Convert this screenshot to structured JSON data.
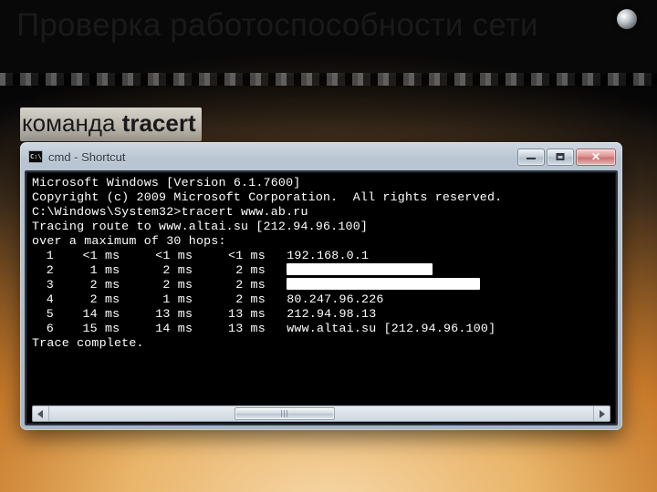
{
  "slide": {
    "title": "Проверка работоспособности сети",
    "subtitle_prefix": "команда ",
    "subtitle_cmd": "tracert"
  },
  "window": {
    "title": "cmd - Shortcut",
    "buttons": {
      "min": "Minimize",
      "max": "Maximize",
      "close": "Close"
    }
  },
  "terminal": {
    "header1": "Microsoft Windows [Version 6.1.7600]",
    "header2": "Copyright (c) 2009 Microsoft Corporation.  All rights reserved.",
    "prompt": "C:\\Windows\\System32>",
    "command": "tracert www.ab.ru",
    "tracing1": "Tracing route to www.altai.su [212.94.96.100]",
    "tracing2": "over a maximum of 30 hops:",
    "hops": [
      {
        "n": "1",
        "t1": "<1",
        "t2": "<1",
        "t3": "<1",
        "dest": "192.168.0.1",
        "blur": null
      },
      {
        "n": "2",
        "t1": "1",
        "t2": "2",
        "t3": "2",
        "dest": "",
        "blur": "wb1"
      },
      {
        "n": "3",
        "t1": "2",
        "t2": "2",
        "t3": "2",
        "dest": "",
        "blur": "wb2"
      },
      {
        "n": "4",
        "t1": "2",
        "t2": "1",
        "t3": "2",
        "dest": "80.247.96.226",
        "blur": null
      },
      {
        "n": "5",
        "t1": "14",
        "t2": "13",
        "t3": "13",
        "dest": "212.94.98.13",
        "blur": null
      },
      {
        "n": "6",
        "t1": "15",
        "t2": "14",
        "t3": "13",
        "dest": "www.altai.su [212.94.96.100]",
        "blur": null
      }
    ],
    "unit": "ms",
    "complete": "Trace complete."
  }
}
